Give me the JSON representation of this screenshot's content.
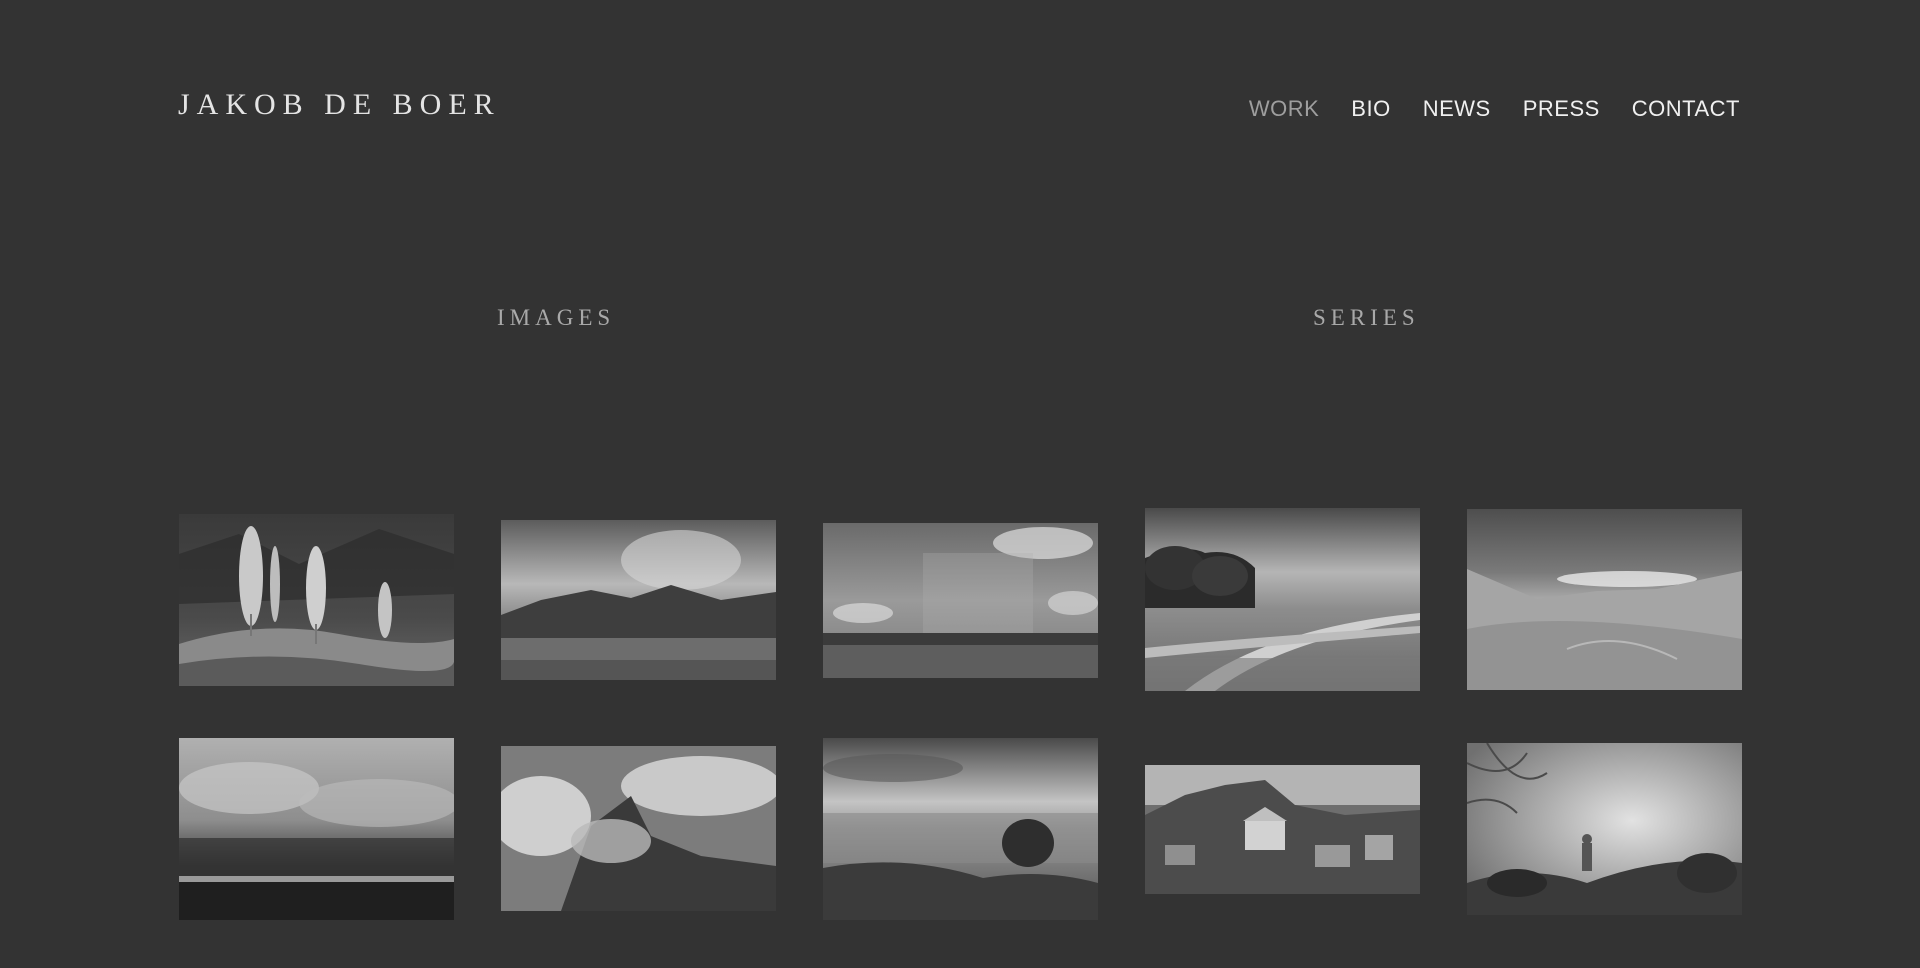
{
  "site": {
    "title": "JAKOB DE BOER"
  },
  "nav": {
    "items": [
      {
        "label": "WORK",
        "active": true
      },
      {
        "label": "BIO",
        "active": false
      },
      {
        "label": "NEWS",
        "active": false
      },
      {
        "label": "PRESS",
        "active": false
      },
      {
        "label": "CONTACT",
        "active": false
      }
    ]
  },
  "sections": {
    "images_label": "IMAGES",
    "series_label": "SERIES"
  },
  "gallery": {
    "style": "black-and-white landscape photographs",
    "photos": [
      {
        "subject": "poplar trees on rocky hillside"
      },
      {
        "subject": "storm clouds over mountain range"
      },
      {
        "subject": "rain curtain over plateau"
      },
      {
        "subject": "trees and road in cloudy landscape"
      },
      {
        "subject": "snowy mountain valley"
      },
      {
        "subject": "misty lake and forest"
      },
      {
        "subject": "mountain peak in clouds"
      },
      {
        "subject": "field with tree under clouds"
      },
      {
        "subject": "hillside village with church"
      },
      {
        "subject": "figure in foggy forest"
      }
    ]
  }
}
